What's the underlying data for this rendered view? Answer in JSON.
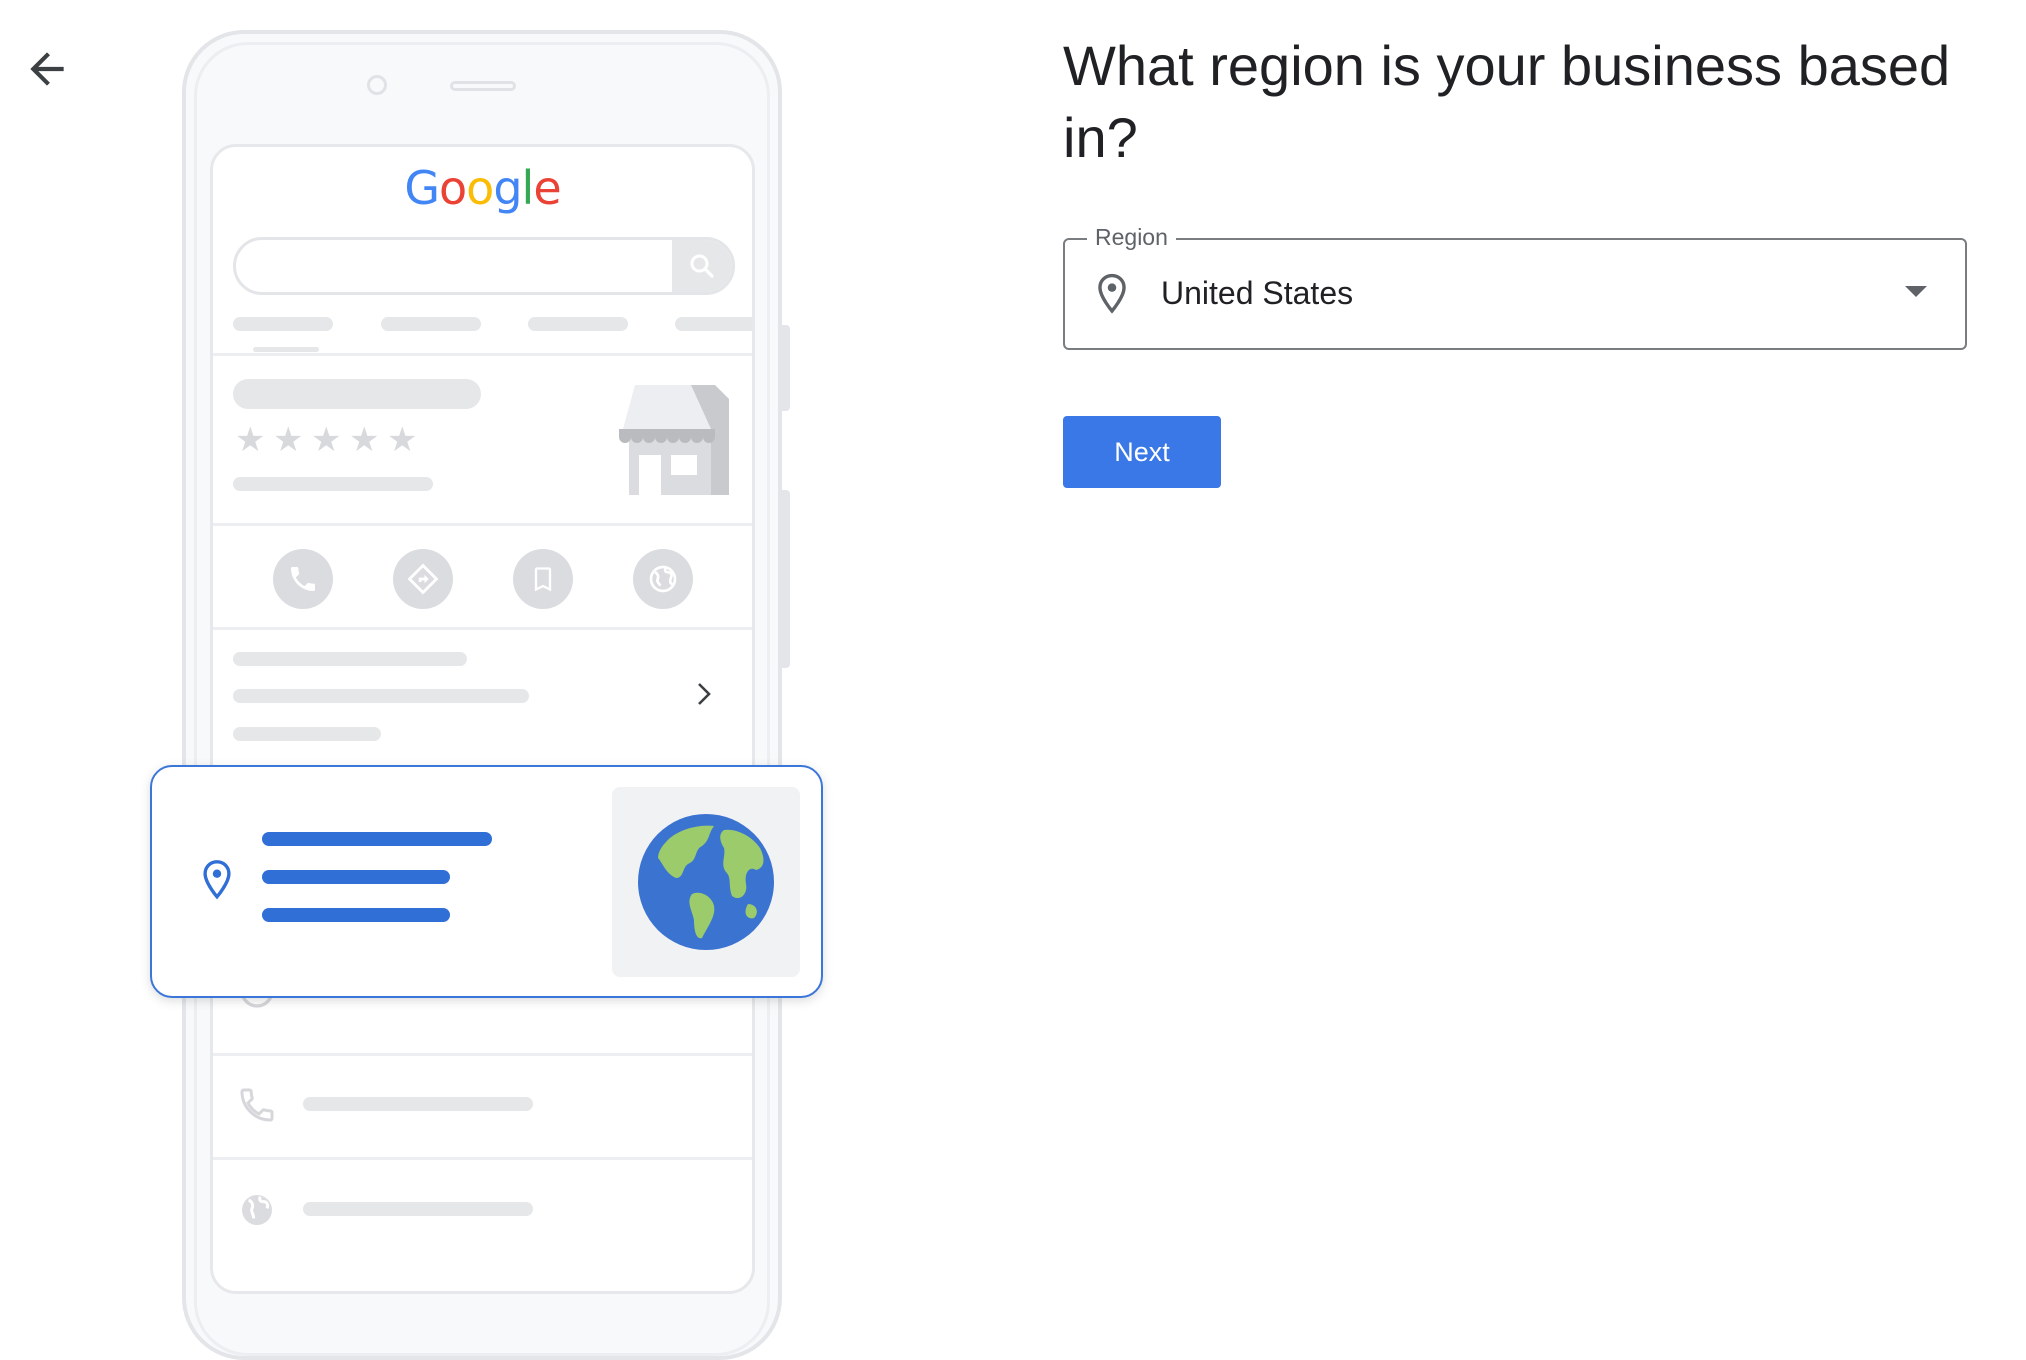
{
  "nav": {
    "back_icon": "arrow-left-icon"
  },
  "heading": {
    "title": "What region is your business based in?"
  },
  "form": {
    "region_field": {
      "label": "Region",
      "value": "United States",
      "leading_icon": "location-pin-icon",
      "trailing_icon": "dropdown-arrow-icon"
    },
    "next_label": "Next"
  },
  "illustration": {
    "logo_letters": [
      "G",
      "o",
      "o",
      "g",
      "l",
      "e"
    ],
    "star_count": 5,
    "action_icons": [
      "phone-icon",
      "directions-icon",
      "bookmark-icon",
      "globe-icon"
    ],
    "detail_icons": [
      "clock-icon",
      "phone-icon",
      "globe-icon"
    ],
    "card_icons": [
      "location-pin-icon",
      "globe-image"
    ]
  },
  "colors": {
    "primary": "#3b78e7",
    "card_accent": "#2f6fd6",
    "text": "#202124",
    "muted": "#5f6368",
    "placeholder": "#e6e7e9",
    "google_blue": "#4285f4",
    "google_red": "#ea4335",
    "google_yellow": "#fbbc05",
    "google_green": "#34a853"
  }
}
